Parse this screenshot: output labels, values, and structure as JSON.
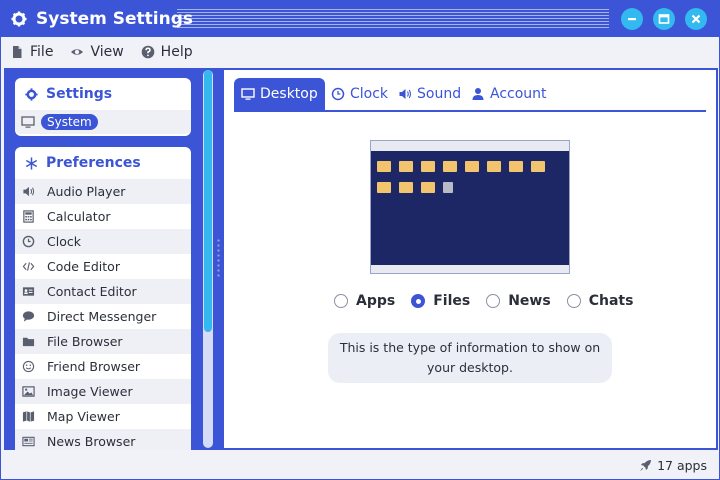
{
  "window": {
    "title": "System Settings",
    "accent": "#3b55d6",
    "button_color": "#34b8f0",
    "title_icon": "gear-icon",
    "controls": [
      "minimize-icon",
      "maximize-icon",
      "close-icon"
    ]
  },
  "menu": [
    {
      "label": "File",
      "icon": "file-icon"
    },
    {
      "label": "View",
      "icon": "eye-icon"
    },
    {
      "label": "Help",
      "icon": "help-circle-icon"
    }
  ],
  "sidebar": {
    "settings_header": "Settings",
    "settings_icon": "gear-icon",
    "system_label": "System",
    "system_icon": "monitor-icon",
    "prefs_header": "Preferences",
    "prefs_icon": "snowflake-icon",
    "items": [
      {
        "label": "Audio Player",
        "icon": "speaker-icon"
      },
      {
        "label": "Calculator",
        "icon": "calculator-icon"
      },
      {
        "label": "Clock",
        "icon": "clock-icon"
      },
      {
        "label": "Code Editor",
        "icon": "code-icon"
      },
      {
        "label": "Contact Editor",
        "icon": "contact-card-icon"
      },
      {
        "label": "Direct Messenger",
        "icon": "chat-bubble-icon"
      },
      {
        "label": "File Browser",
        "icon": "folder-icon"
      },
      {
        "label": "Friend Browser",
        "icon": "smiley-icon"
      },
      {
        "label": "Image Viewer",
        "icon": "image-icon"
      },
      {
        "label": "Map Viewer",
        "icon": "map-icon"
      },
      {
        "label": "News Browser",
        "icon": "newspaper-icon"
      }
    ]
  },
  "tabs": [
    {
      "label": "Desktop",
      "icon": "monitor-icon",
      "active": true
    },
    {
      "label": "Clock",
      "icon": "clock-icon",
      "active": false
    },
    {
      "label": "Sound",
      "icon": "speaker-icon",
      "active": false
    },
    {
      "label": "Account",
      "icon": "user-icon",
      "active": false
    }
  ],
  "desktop": {
    "options": [
      {
        "label": "Apps",
        "selected": false
      },
      {
        "label": "Files",
        "selected": true
      },
      {
        "label": "News",
        "selected": false
      },
      {
        "label": "Chats",
        "selected": false
      }
    ],
    "info_text": "This is the type of information to show on your desktop."
  },
  "status": {
    "text": "17 apps",
    "icon": "rocket-icon"
  }
}
